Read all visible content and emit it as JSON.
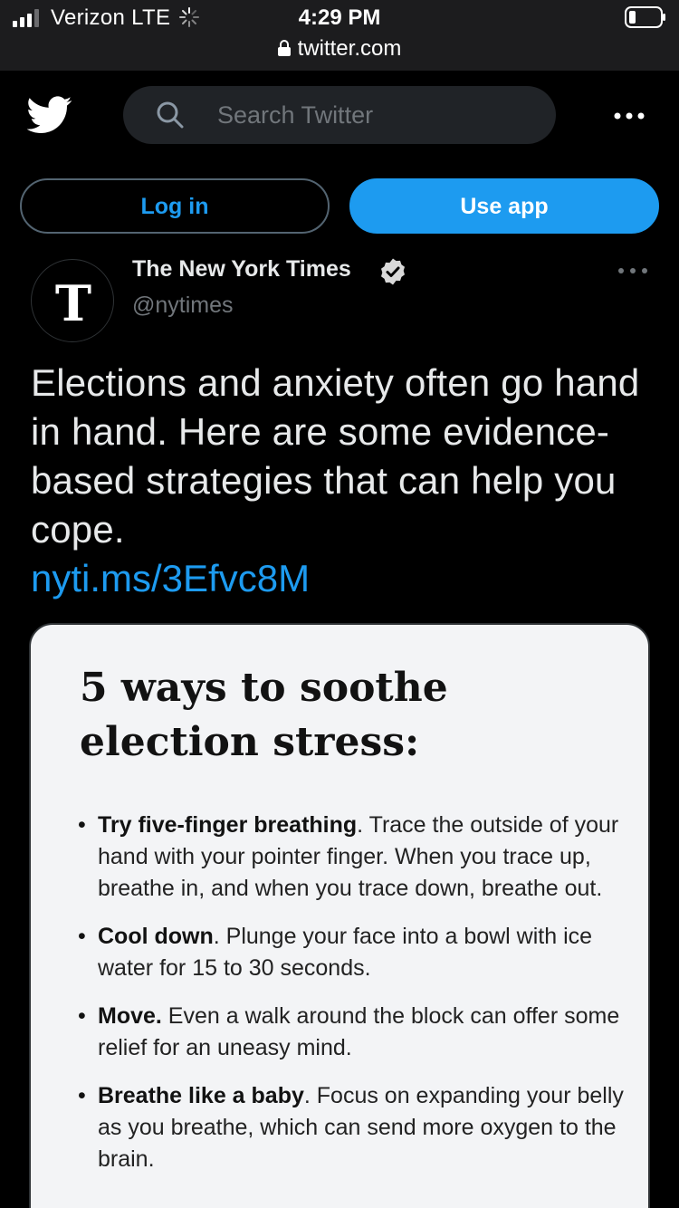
{
  "status_bar": {
    "carrier": "Verizon  LTE",
    "time": "4:29 PM",
    "url": "twitter.com"
  },
  "header": {
    "search_placeholder": "Search Twitter"
  },
  "buttons": {
    "login": "Log in",
    "use_app": "Use app"
  },
  "tweet": {
    "avatar_letter": "T",
    "name": "The New York Times",
    "handle": "@nytimes",
    "text": "Elections and anxiety often go hand in hand. Here are some evidence-based strategies that can help you cope.",
    "link": "nyti.ms/3Efvc8M"
  },
  "card": {
    "title": "5 ways to soothe election stress:",
    "tips": [
      {
        "bold": "Try five-finger breathing",
        "text": ". Trace the outside of your hand with your pointer finger. When you trace up, breathe in, and when you trace down, breathe out."
      },
      {
        "bold": "Cool down",
        "text": ". Plunge your face into a bowl with ice water for 15 to 30 seconds."
      },
      {
        "bold": "Move.",
        "text": " Even a walk around the block can offer some relief for an uneasy mind."
      },
      {
        "bold": "Breathe like a baby",
        "text": ". Focus on expanding your belly as you breathe, which can send more oxygen to the brain."
      }
    ]
  },
  "icons": {
    "logo": "twitter-bird-icon",
    "search": "search-icon",
    "more": "more-dots-icon",
    "verified": "verified-badge-icon",
    "lock": "lock-icon"
  },
  "colors": {
    "accent": "#1d9bf0",
    "background": "#000000",
    "muted_text": "#71767b"
  }
}
